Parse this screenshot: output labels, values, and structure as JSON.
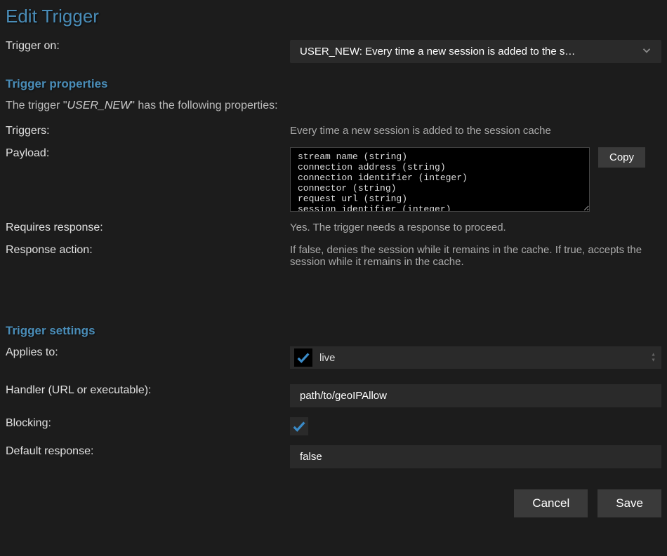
{
  "header": {
    "title": "Edit Trigger"
  },
  "trigger_on": {
    "label": "Trigger on:",
    "value": "USER_NEW: Every time a new session is added to the s…"
  },
  "properties": {
    "section_title": "Trigger properties",
    "intro_pre": "The trigger \"",
    "intro_name": "USER_NEW",
    "intro_post": "\" has the following properties:",
    "triggers": {
      "label": "Triggers:",
      "value": "Every time a new session is added to the session cache"
    },
    "payload": {
      "label": "Payload:",
      "value": "stream name (string)\nconnection address (string)\nconnection identifier (integer)\nconnector (string)\nrequest url (string)\nsession identifier (integer)",
      "copy_label": "Copy"
    },
    "requires_response": {
      "label": "Requires response:",
      "value": "Yes. The trigger needs a response to proceed."
    },
    "response_action": {
      "label": "Response action:",
      "value": "If false, denies the session while it remains in the cache. If true, accepts the session while it remains in the cache."
    }
  },
  "settings": {
    "section_title": "Trigger settings",
    "applies_to": {
      "label": "Applies to:",
      "checked": true,
      "value": "live"
    },
    "handler": {
      "label": "Handler (URL or executable):",
      "value": "path/to/geoIPAllow"
    },
    "blocking": {
      "label": "Blocking:",
      "checked": true
    },
    "default_response": {
      "label": "Default response:",
      "value": "false"
    }
  },
  "actions": {
    "cancel": "Cancel",
    "save": "Save"
  }
}
